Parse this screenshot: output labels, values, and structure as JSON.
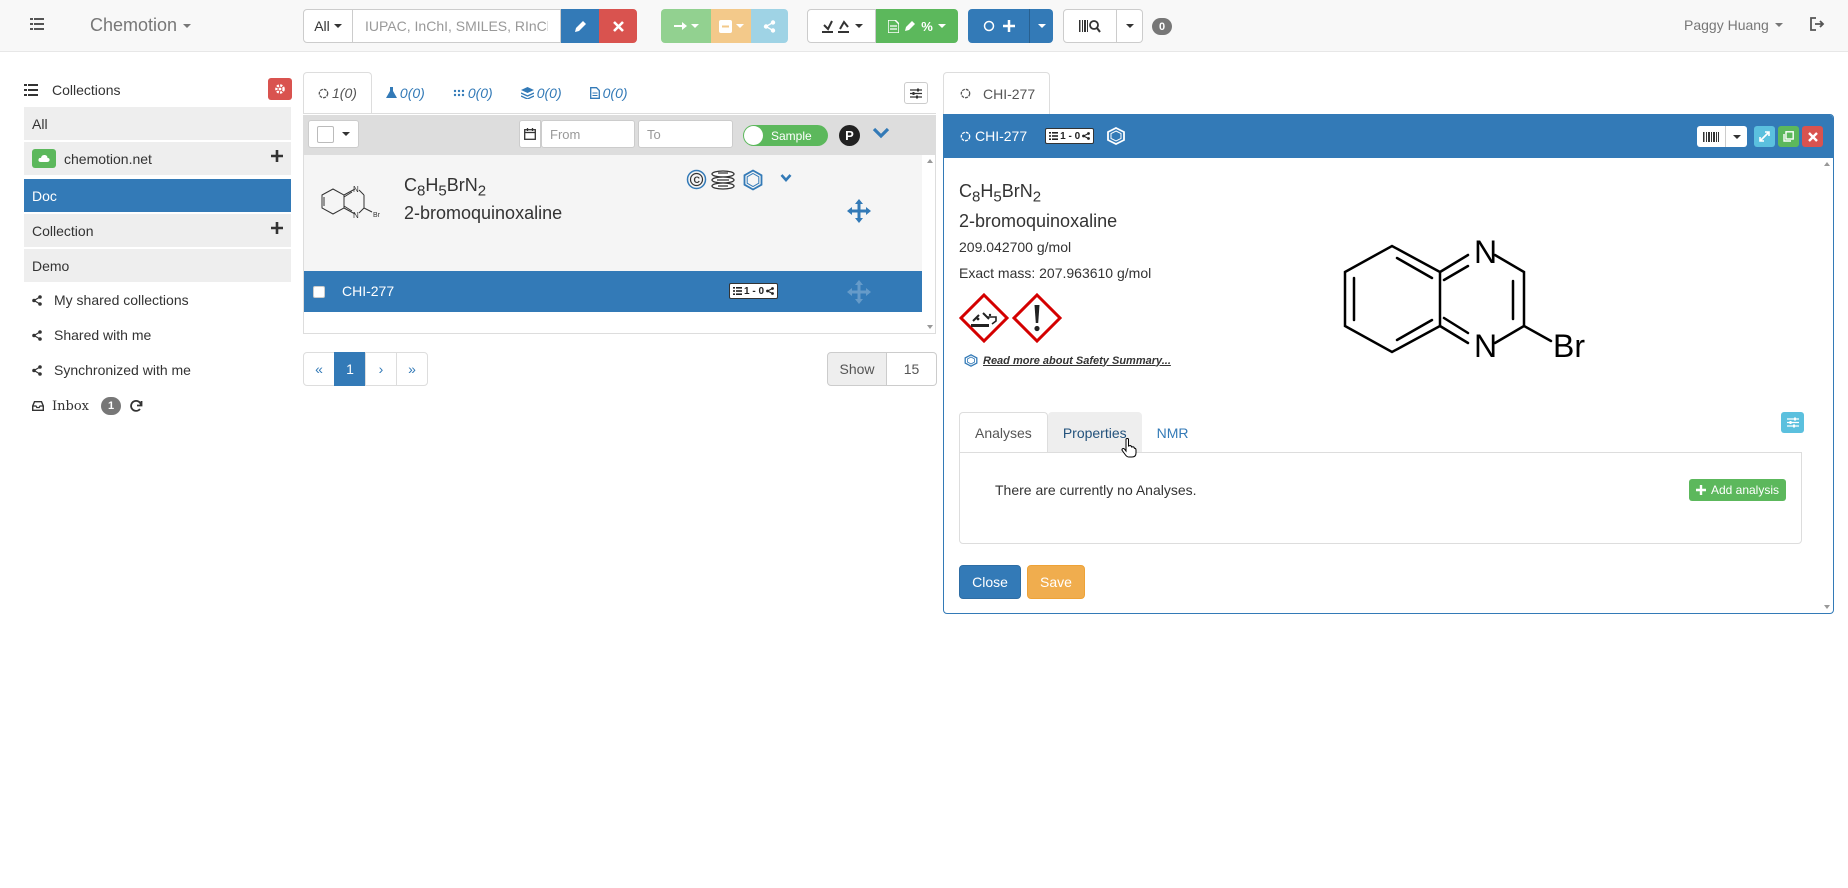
{
  "navbar": {
    "brand": "Chemotion",
    "search_scope": "All",
    "search_placeholder": "IUPAC, InChI, SMILES, RInChI...",
    "notification_count": "0",
    "user_name": "Paggy Huang"
  },
  "sidebar": {
    "title": "Collections",
    "items": [
      {
        "label": "All"
      },
      {
        "label": "chemotion.net"
      },
      {
        "label": "Doc"
      },
      {
        "label": "Collection"
      },
      {
        "label": "Demo"
      }
    ],
    "links": [
      {
        "label": "My shared collections"
      },
      {
        "label": "Shared with me"
      },
      {
        "label": "Synchronized with me"
      }
    ],
    "inbox_label": "Inbox",
    "inbox_count": "1"
  },
  "list": {
    "tabs": [
      {
        "label": "1(0)",
        "icon": "sample-icon"
      },
      {
        "label": "0(0)",
        "icon": "reaction-icon"
      },
      {
        "label": "0(0)",
        "icon": "wellplate-icon"
      },
      {
        "label": "0(0)",
        "icon": "screen-icon"
      },
      {
        "label": "0(0)",
        "icon": "research-plan-icon"
      }
    ],
    "from_placeholder": "From",
    "to_placeholder": "To",
    "toggle_label": "Sample",
    "p_label": "P",
    "sample": {
      "formula_main": "C",
      "formula_parts": [
        [
          "C",
          "8"
        ],
        [
          "H",
          "5"
        ],
        [
          "Br",
          ""
        ],
        [
          "N",
          "2"
        ]
      ],
      "name": "2-bromoquinoxaline"
    },
    "row": {
      "label": "CHI-277",
      "tag": "1 - 0"
    },
    "pagination": {
      "first": "«",
      "current": "1",
      "next": "›",
      "last": "»"
    },
    "show_label": "Show",
    "show_value": "15"
  },
  "detail": {
    "tab_label": "CHI-277",
    "header_title": "CHI-277",
    "header_tag": "1 - 0",
    "formula_parts": [
      [
        "C",
        "8"
      ],
      [
        "H",
        "5"
      ],
      [
        "Br",
        ""
      ],
      [
        "N",
        "2"
      ]
    ],
    "name": "2-bromoquinoxaline",
    "molecular_weight": "209.042700 g/mol",
    "exact_mass": "Exact mass: 207.963610 g/mol",
    "safety_link": "Read more about Safety Summary...",
    "ghs_icons": [
      "ghs05-corrosive-icon",
      "ghs07-exclamation-icon"
    ],
    "structure_labels": {
      "n1": "N",
      "n2": "N",
      "br": "Br"
    },
    "analysis_tabs": [
      {
        "label": "Analyses"
      },
      {
        "label": "Properties"
      },
      {
        "label": "NMR"
      }
    ],
    "empty_analyses": "There are currently no Analyses.",
    "add_analysis": "Add analysis",
    "close_label": "Close",
    "save_label": "Save"
  },
  "colors": {
    "primary": "#337ab7",
    "success": "#5cb85c",
    "danger": "#d9534f",
    "warning": "#f0ad4e",
    "info": "#5bc0de"
  }
}
